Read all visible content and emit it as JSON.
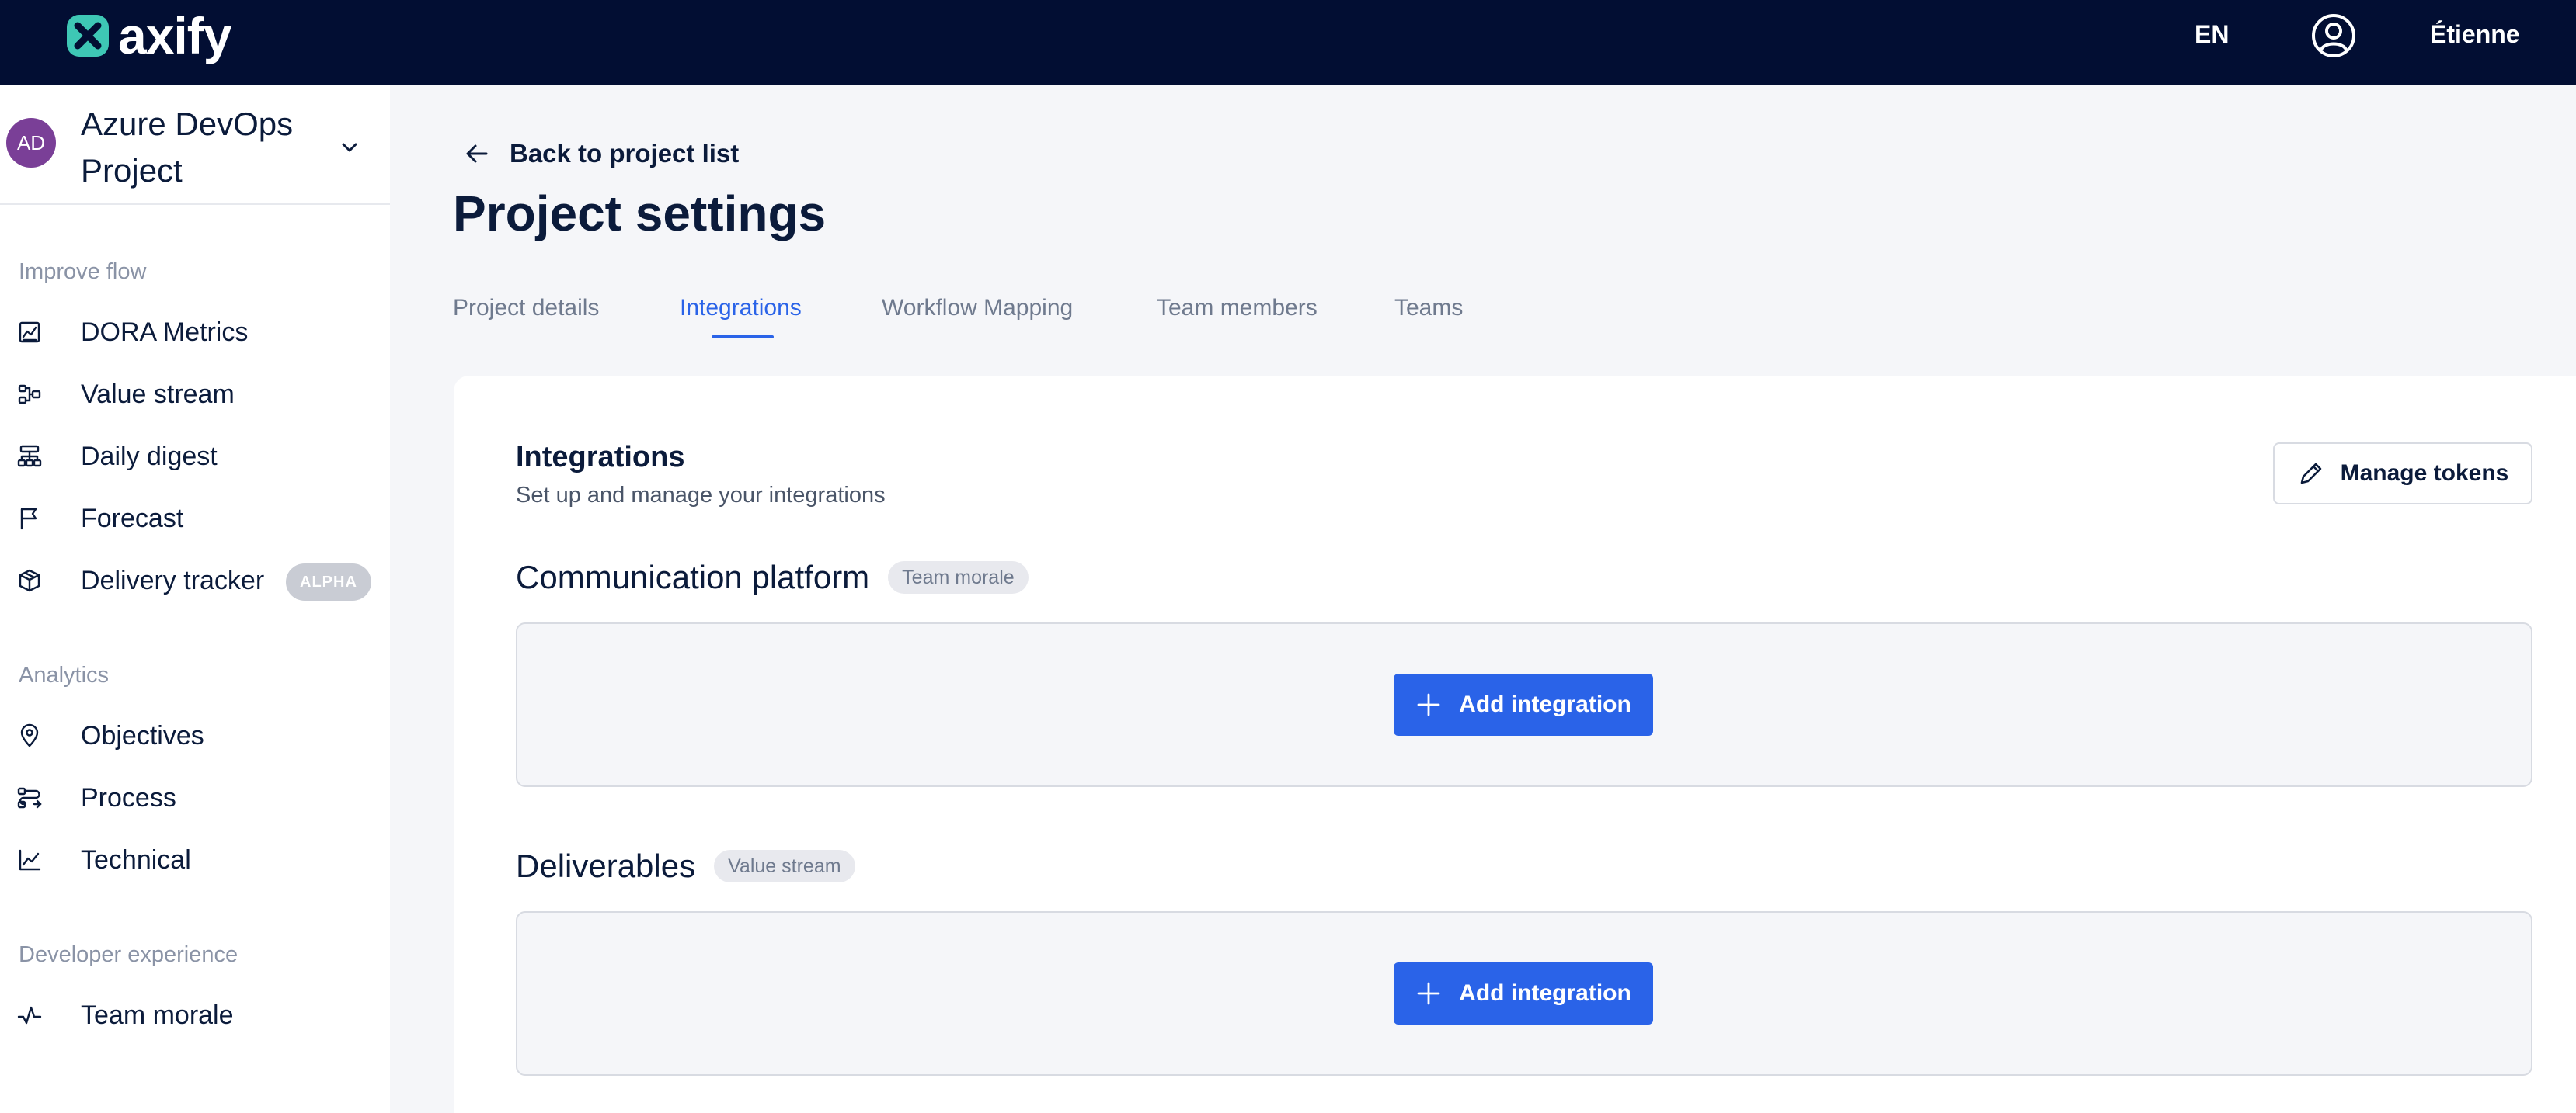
{
  "header": {
    "logo_text": "axify",
    "language": "EN",
    "user_name": "Étienne"
  },
  "sidebar": {
    "project": {
      "avatar_initials": "AD",
      "name": "Azure DevOps Project"
    },
    "sections": [
      {
        "title": "Improve flow",
        "items": [
          {
            "label": "DORA Metrics",
            "icon": "chart-icon"
          },
          {
            "label": "Value stream",
            "icon": "value-stream-icon"
          },
          {
            "label": "Daily digest",
            "icon": "hierarchy-icon"
          },
          {
            "label": "Forecast",
            "icon": "flag-icon"
          },
          {
            "label": "Delivery tracker",
            "icon": "package-icon",
            "badge": "ALPHA"
          }
        ]
      },
      {
        "title": "Analytics",
        "items": [
          {
            "label": "Objectives",
            "icon": "map-pin-icon"
          },
          {
            "label": "Process",
            "icon": "process-icon"
          },
          {
            "label": "Technical",
            "icon": "trend-line-icon"
          }
        ]
      },
      {
        "title": "Developer experience",
        "items": [
          {
            "label": "Team morale",
            "icon": "pulse-icon"
          }
        ]
      }
    ]
  },
  "main": {
    "back_link": "Back to project list",
    "page_title": "Project settings",
    "tabs": [
      {
        "label": "Project details",
        "active": false
      },
      {
        "label": "Integrations",
        "active": true
      },
      {
        "label": "Workflow Mapping",
        "active": false
      },
      {
        "label": "Team members",
        "active": false
      },
      {
        "label": "Teams",
        "active": false
      }
    ],
    "integrations": {
      "title": "Integrations",
      "subtitle": "Set up and manage your integrations",
      "manage_tokens_label": "Manage tokens",
      "sections": [
        {
          "title": "Communication platform",
          "tag": "Team morale",
          "button_label": "Add integration"
        },
        {
          "title": "Deliverables",
          "tag": "Value stream",
          "button_label": "Add integration"
        }
      ]
    }
  },
  "colors": {
    "topbar_bg": "#020e33",
    "accent": "#2a63e8",
    "avatar_bg": "#7a3f97",
    "logo_teal": "#3ec7b5"
  }
}
